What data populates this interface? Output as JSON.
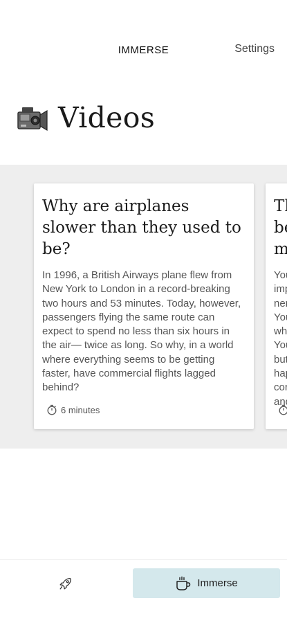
{
  "header": {
    "brand": "IMMERSE",
    "settings_label": "Settings"
  },
  "section": {
    "icon": "video-camera-icon",
    "title": "Videos"
  },
  "cards": [
    {
      "title": "Why are airplanes slower than they used to be?",
      "description": "In 1996, a British Airways plane flew from New York to London in a record-breaking two hours and 53 minutes. Today, however, passengers flying the same route can expect to spend no less than six hours in the air— twice as long. So why, in a world where everything seems to be getting faster, have commercial flights lagged behind?",
      "duration": "6 minutes"
    },
    {
      "title": "The be m",
      "description": "You imp ner You wh You but hap cor and",
      "duration": ""
    }
  ],
  "bottom_nav": {
    "discover_icon": "rocket-icon",
    "immerse_icon": "coffee-cup-icon",
    "immerse_label": "Immerse",
    "active_color": "#d4e8ec"
  }
}
